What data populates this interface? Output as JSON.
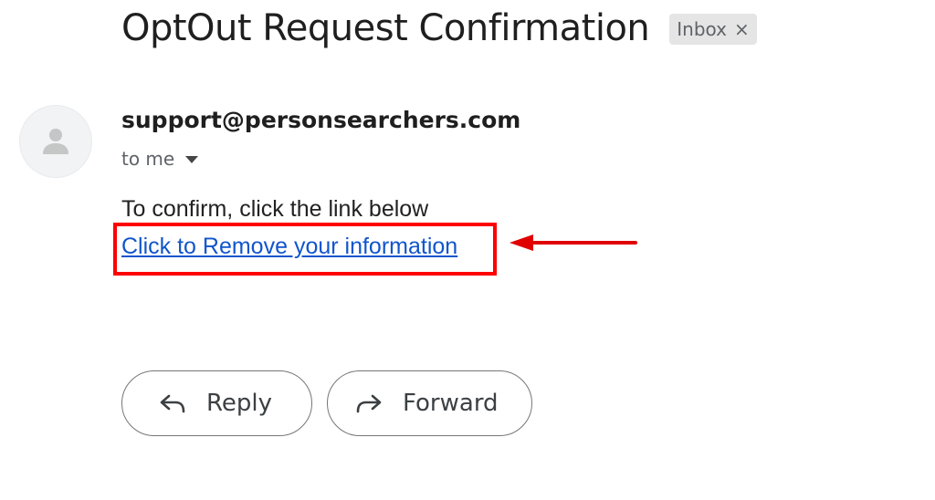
{
  "email": {
    "subject": "OptOut Request Confirmation",
    "label": "Inbox",
    "label_remove_glyph": "×",
    "sender_email": "support@personsearchers.com",
    "recipient": "to me",
    "body_line": "To confirm, click the link below",
    "link_text": "Click to Remove your information"
  },
  "actions": {
    "reply_label": "Reply",
    "forward_label": "Forward"
  },
  "annotation": {
    "highlight_color": "#ff0000"
  },
  "colors": {
    "link": "#1155cc",
    "chip_bg": "#e5e5e5",
    "avatar_bg": "#f1f3f4"
  },
  "icons": {
    "avatar": "person-icon",
    "recipient_caret": "caret-down-icon",
    "reply": "reply-arrow-icon",
    "forward": "forward-arrow-icon",
    "annotation": "red-arrow-icon"
  }
}
